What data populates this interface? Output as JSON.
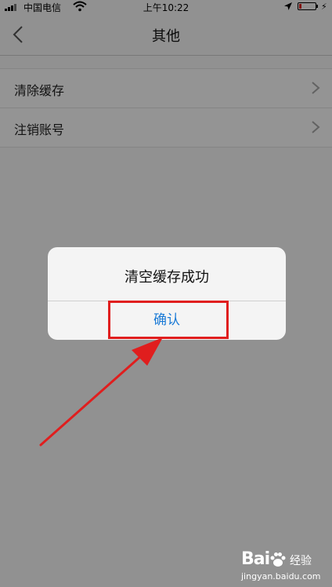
{
  "status_bar": {
    "carrier": "中国电信",
    "time": "上午10:22",
    "battery_level": 0.15
  },
  "nav": {
    "title": "其他"
  },
  "list": {
    "items": [
      {
        "label": "清除缓存"
      },
      {
        "label": "注销账号"
      }
    ]
  },
  "alert": {
    "message": "清空缓存成功",
    "confirm_label": "确认"
  },
  "watermark": {
    "brand": "Bai",
    "brand_suffix": "经验",
    "url": "jingyan.baidu.com"
  },
  "colors": {
    "accent_button": "#1a7ad6",
    "annotation_red": "#e01e1e",
    "battery_low": "#e0201a"
  }
}
